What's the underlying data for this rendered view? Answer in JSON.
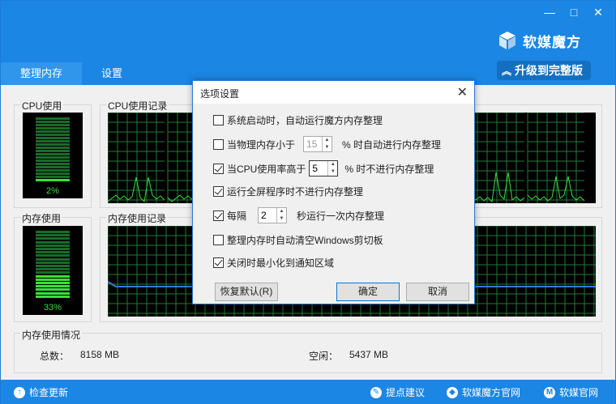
{
  "window": {
    "controls": [
      "—",
      "□",
      "✕"
    ]
  },
  "logo": {
    "text": "软媒魔方"
  },
  "upgrade": {
    "label": "升级到完整版",
    "icon": "double-chevron-up-icon"
  },
  "tabs": [
    {
      "label": "整理内存",
      "active": true
    },
    {
      "label": "设置",
      "active": false
    }
  ],
  "cpu": {
    "usage_label": "CPU使用",
    "history_label": "CPU使用记录",
    "percent_text": "2%",
    "usage": 0.02
  },
  "memory": {
    "usage_label": "内存使用",
    "history_label": "内存使用记录",
    "percent_text": "33%",
    "usage": 0.33
  },
  "stats": {
    "section_label": "内存使用情况",
    "total_label": "总数：",
    "total_value": "8158 MB",
    "free_label": "空闲：",
    "free_value": "5437 MB"
  },
  "footer": {
    "check_update": "检查更新",
    "feedback": "提点建议",
    "official_site": "软媒魔方官网",
    "ruanmei_site": "软媒官网"
  },
  "dialog": {
    "title": "选项设置",
    "options": {
      "autostart": {
        "label": "系统启动时，自动运行魔方内存整理",
        "checked": false
      },
      "mem_low_prefix": "当物理内存小于",
      "mem_low_value": "15",
      "mem_low_suffix": "% 时自动进行内存整理",
      "mem_low_checked": false,
      "cpu_high_prefix": "当CPU使用率高于",
      "cpu_high_value": "5",
      "cpu_high_suffix": "% 时不进行内存整理",
      "cpu_high_checked": true,
      "fullscreen": {
        "label": "运行全屏程序时不进行内存整理",
        "checked": true
      },
      "interval_prefix": "每隔",
      "interval_value": "2",
      "interval_suffix": "秒运行一次内存整理",
      "interval_checked": true,
      "clipboard": {
        "label": "整理内存时自动清空Windows剪切板",
        "checked": false
      },
      "minimize_tray": {
        "label": "关闭时最小化到通知区域",
        "checked": true
      }
    },
    "buttons": {
      "restore": "恢复默认(R)",
      "ok": "确定",
      "cancel": "取消"
    }
  },
  "colors": {
    "titlebar": "#1b86e3",
    "graph_bg": "#000000",
    "graph_grid": "#1f7a3a",
    "meter_on": "#38e038",
    "meter_off": "#1a6b2a",
    "mem_line": "#3a7bd5"
  }
}
